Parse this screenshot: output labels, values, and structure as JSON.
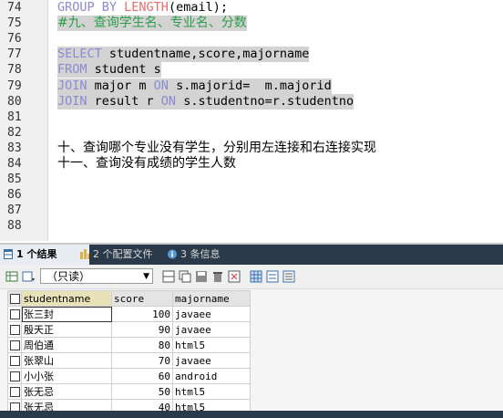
{
  "editor": {
    "lines": [
      {
        "num": "74",
        "segments": [
          {
            "t": "GROUP BY ",
            "cls": "kw"
          },
          {
            "t": "LENGTH",
            "cls": "fn"
          },
          {
            "t": "(email);",
            "cls": ""
          }
        ]
      },
      {
        "num": "75",
        "hl": true,
        "segments": [
          {
            "t": "#九、查询学生名、专业名、分数",
            "cls": "cmt cn"
          }
        ]
      },
      {
        "num": "76",
        "segments": []
      },
      {
        "num": "77",
        "hl": true,
        "segments": [
          {
            "t": "SELECT ",
            "cls": "kw"
          },
          {
            "t": "studentname,score,majorname",
            "cls": ""
          }
        ]
      },
      {
        "num": "78",
        "hl": true,
        "segments": [
          {
            "t": "FROM ",
            "cls": "kw"
          },
          {
            "t": "student s",
            "cls": ""
          }
        ]
      },
      {
        "num": "79",
        "hl": true,
        "segments": [
          {
            "t": "JOIN ",
            "cls": "kw"
          },
          {
            "t": "major m ",
            "cls": ""
          },
          {
            "t": "ON ",
            "cls": "kw"
          },
          {
            "t": "s.majorid=  m.majorid",
            "cls": ""
          }
        ]
      },
      {
        "num": "80",
        "hl": true,
        "segments": [
          {
            "t": "JOIN ",
            "cls": "kw"
          },
          {
            "t": "result r ",
            "cls": ""
          },
          {
            "t": "ON ",
            "cls": "kw"
          },
          {
            "t": "s.studentno=r.studentno",
            "cls": ""
          }
        ]
      },
      {
        "num": "81",
        "segments": []
      },
      {
        "num": "82",
        "segments": []
      },
      {
        "num": "83",
        "segments": [
          {
            "t": "十、查询哪个专业没有学生，分别用左连接和右连接实现",
            "cls": "cn"
          }
        ]
      },
      {
        "num": "84",
        "segments": [
          {
            "t": "十一、查询没有成绩的学生人数",
            "cls": "cn"
          }
        ]
      },
      {
        "num": "85",
        "segments": []
      },
      {
        "num": "86",
        "segments": []
      },
      {
        "num": "87",
        "segments": []
      },
      {
        "num": "88",
        "segments": []
      }
    ]
  },
  "results": {
    "tabs": [
      {
        "label": "1 个结果",
        "active": true,
        "icon": "table-icon"
      },
      {
        "label": "2 个配置文件",
        "active": false,
        "icon": "profile-icon"
      },
      {
        "label": "3 条信息",
        "active": false,
        "icon": "info-icon"
      }
    ],
    "mode_select": "（只读）",
    "columns": [
      "studentname",
      "score",
      "majorname"
    ],
    "rows": [
      [
        "张三封",
        "100",
        "javaee"
      ],
      [
        "殷天正",
        "90",
        "javaee"
      ],
      [
        "周伯通",
        "80",
        "html5"
      ],
      [
        "张翠山",
        "70",
        "javaee"
      ],
      [
        "小小张",
        "60",
        "android"
      ],
      [
        "张无忌",
        "50",
        "html5"
      ],
      [
        "张无忌",
        "40",
        "html5"
      ]
    ]
  },
  "colors": {
    "keyword": "#8a8ad0",
    "function": "#e07070",
    "comment": "#2e9c4a",
    "selection": "#d3d3d3",
    "tabbar": "#2b3a4a"
  }
}
